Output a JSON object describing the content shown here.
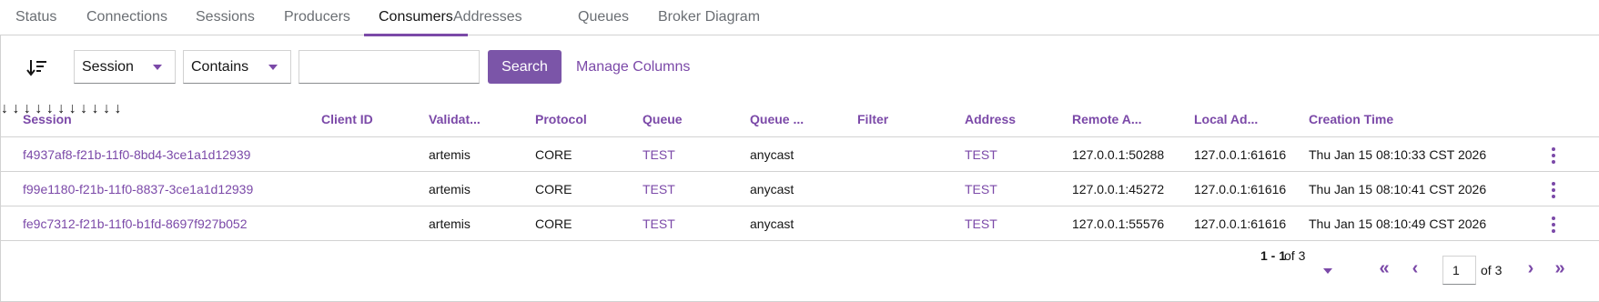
{
  "tabs": [
    {
      "label": "Status"
    },
    {
      "label": "Connections"
    },
    {
      "label": "Sessions"
    },
    {
      "label": "Producers"
    },
    {
      "label": "Consumers",
      "active": true
    },
    {
      "label": "Addresses"
    },
    {
      "label": "Queues"
    },
    {
      "label": "Broker Diagram"
    }
  ],
  "toolbar": {
    "sort_icon": "sort-amount-down-icon",
    "filter_column": "Session",
    "filter_operator": "Contains",
    "search_value": "",
    "search_label": "Search",
    "manage_columns_label": "Manage Columns"
  },
  "table": {
    "columns": [
      {
        "label": "Session"
      },
      {
        "label": "Client ID"
      },
      {
        "label": "Validat..."
      },
      {
        "label": "Protocol"
      },
      {
        "label": "Queue"
      },
      {
        "label": "Queue ..."
      },
      {
        "label": "Filter"
      },
      {
        "label": "Address"
      },
      {
        "label": "Remote A..."
      },
      {
        "label": "Local Ad..."
      },
      {
        "label": "Creation Time"
      }
    ],
    "sort_arrow": "↓",
    "rows": [
      {
        "session": "f4937af8-f21b-11f0-8bd4-3ce1a1d12939",
        "client_id": "",
        "validated": "artemis",
        "protocol": "CORE",
        "queue": "TEST",
        "queue_type": "anycast",
        "filter": "",
        "address": "TEST",
        "remote": "127.0.0.1:50288",
        "local": "127.0.0.1:61616",
        "created": "Thu Jan 15 08:10:33 CST 2026"
      },
      {
        "session": "f99e1180-f21b-11f0-8837-3ce1a1d12939",
        "client_id": "",
        "validated": "artemis",
        "protocol": "CORE",
        "queue": "TEST",
        "queue_type": "anycast",
        "filter": "",
        "address": "TEST",
        "remote": "127.0.0.1:45272",
        "local": "127.0.0.1:61616",
        "created": "Thu Jan 15 08:10:41 CST 2026"
      },
      {
        "session": "fe9c7312-f21b-11f0-b1fd-8697f927b052",
        "client_id": "",
        "validated": "artemis",
        "protocol": "CORE",
        "queue": "TEST",
        "queue_type": "anycast",
        "filter": "",
        "address": "TEST",
        "remote": "127.0.0.1:55576",
        "local": "127.0.0.1:61616",
        "created": "Thu Jan 15 08:10:49 CST 2026"
      }
    ]
  },
  "pagination": {
    "range": "1 - 1",
    "of_label": "of 3",
    "page": "1",
    "total_label": "of 3",
    "first_glyph": "«",
    "prev_glyph": "‹",
    "next_glyph": "›",
    "last_glyph": "»"
  },
  "colors": {
    "accent": "#7b49a8",
    "button": "#7b55a8",
    "border": "#d2d2d2",
    "muted_text": "#6a6e73"
  }
}
